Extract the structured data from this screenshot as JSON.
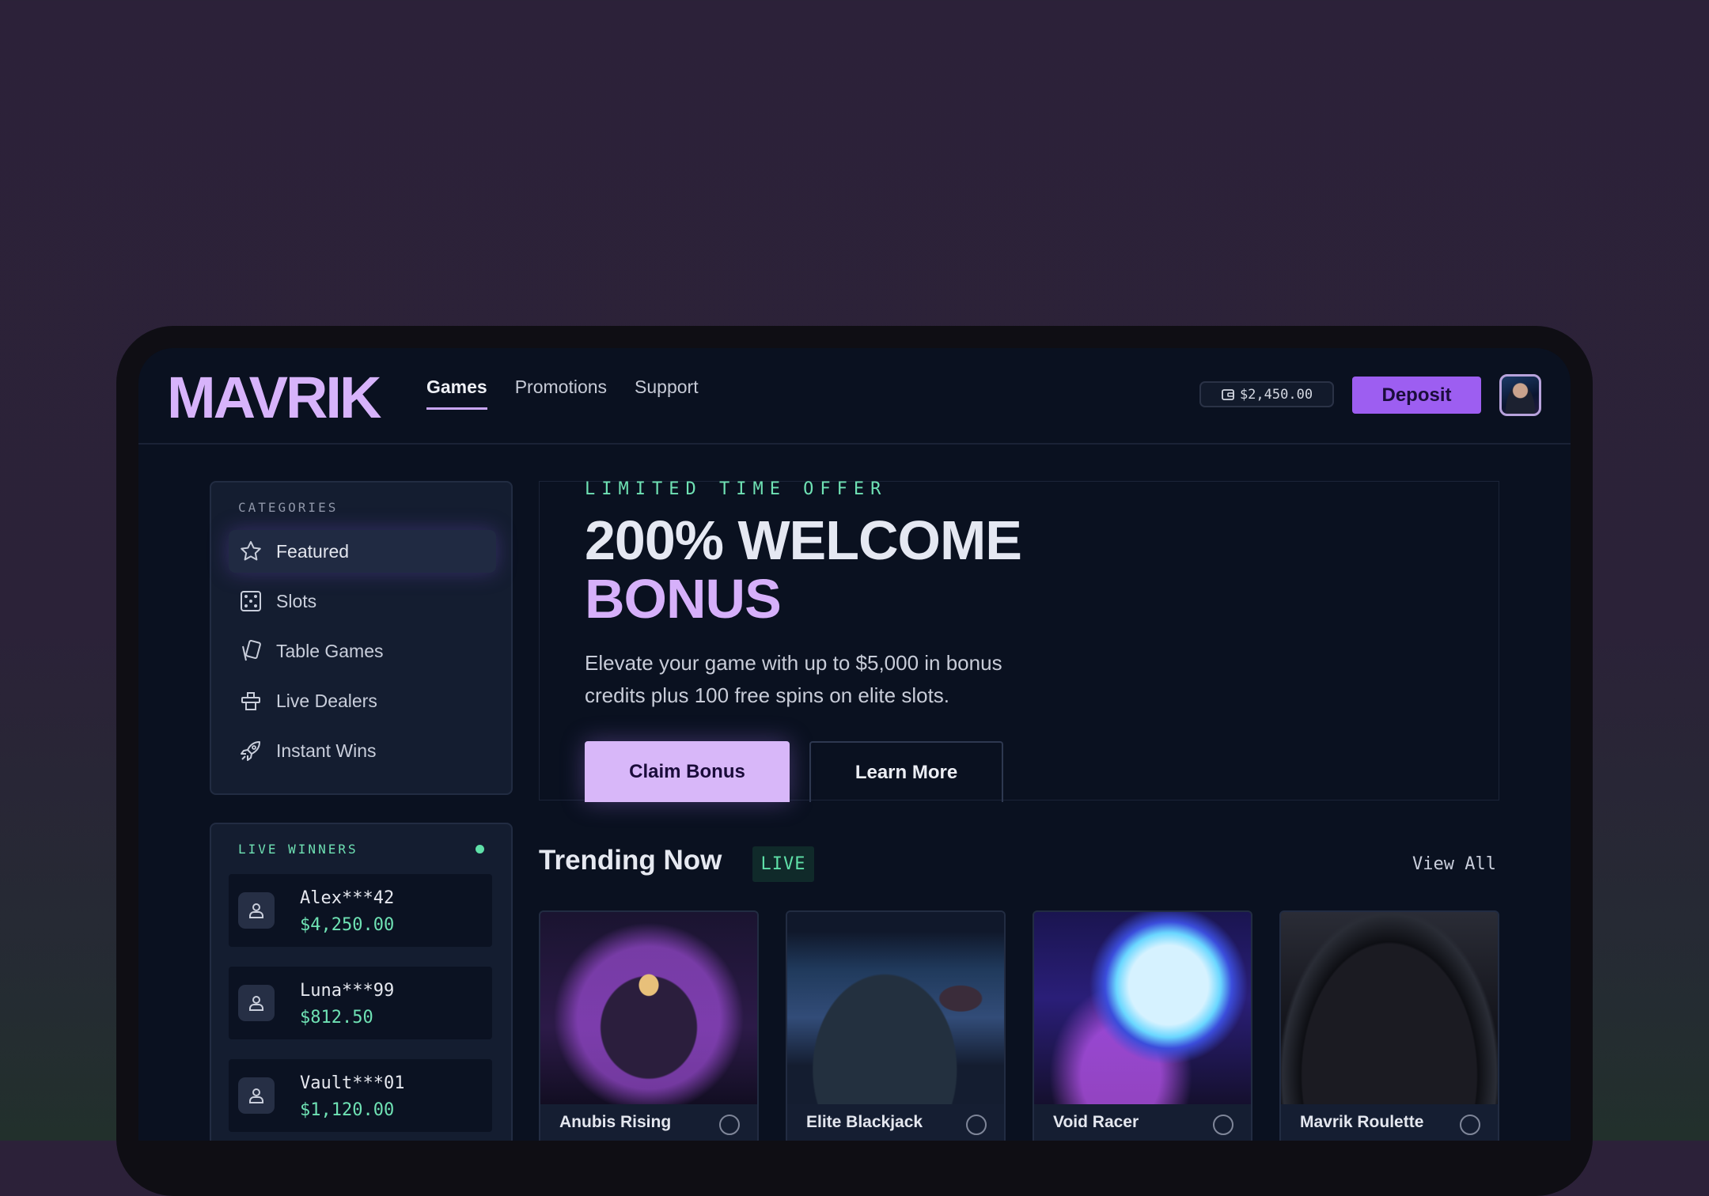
{
  "header": {
    "logo": "MAVRIK",
    "nav": [
      "Games",
      "Promotions",
      "Support"
    ],
    "active_nav": "Games",
    "balance": "$2,450.00",
    "deposit_label": "Deposit"
  },
  "sidebar": {
    "categories_title": "CATEGORIES",
    "categories": [
      {
        "label": "Featured",
        "icon": "star-icon"
      },
      {
        "label": "Slots",
        "icon": "dice-icon"
      },
      {
        "label": "Table Games",
        "icon": "cards-icon"
      },
      {
        "label": "Live Dealers",
        "icon": "dealer-icon"
      },
      {
        "label": "Instant Wins",
        "icon": "rocket-icon"
      }
    ],
    "live_winners_title": "LIVE WINNERS",
    "winners": [
      {
        "name": "Alex***42",
        "amount": "$4,250.00"
      },
      {
        "name": "Luna***99",
        "amount": "$812.50"
      },
      {
        "name": "Vault***01",
        "amount": "$1,120.00"
      }
    ]
  },
  "hero": {
    "eyebrow": "LIMITED TIME OFFER",
    "headline_line1": "200% WELCOME",
    "headline_line2": "BONUS",
    "subtext": "Elevate your game with up to $5,000 in bonus credits plus 100 free spins on elite slots.",
    "primary_cta": "Claim Bonus",
    "secondary_cta": "Learn More"
  },
  "trending": {
    "title": "Trending Now",
    "badge": "LIVE",
    "view_all": "View All",
    "games": [
      {
        "title": "Anubis Rising"
      },
      {
        "title": "Elite Blackjack"
      },
      {
        "title": "Void Racer"
      },
      {
        "title": "Mavrik Roulette"
      }
    ]
  },
  "colors": {
    "accent": "#9d5ef1",
    "accent_light": "#d8b7f9",
    "live_green": "#6fe2b4",
    "background": "#0a1120"
  }
}
